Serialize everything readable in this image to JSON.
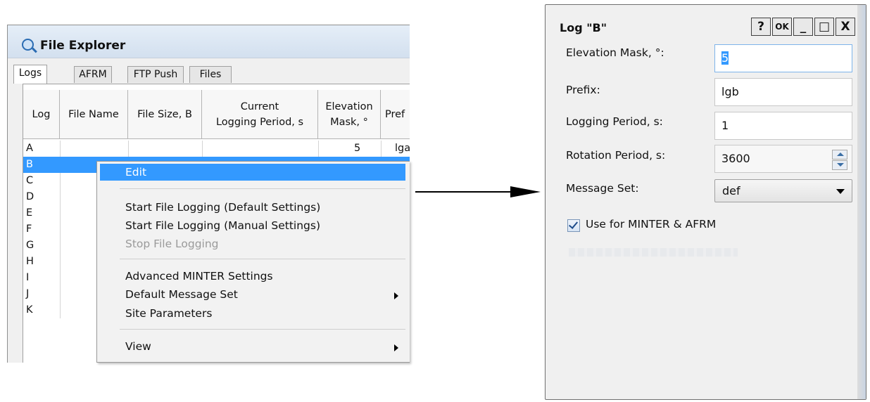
{
  "file_explorer": {
    "title": "File Explorer",
    "tabs": [
      "Logs",
      "AFRM",
      "FTP Push",
      "Files"
    ],
    "columns": [
      "Log",
      "File Name",
      "File Size, B",
      "Current\nLogging Period, s",
      "Elevation\nMask, °",
      "Pref"
    ],
    "rows": [
      {
        "log": "A",
        "mask": "5",
        "prefix": "lga"
      },
      {
        "log": "B"
      },
      {
        "log": "C"
      },
      {
        "log": "D"
      },
      {
        "log": "E"
      },
      {
        "log": "F"
      },
      {
        "log": "G"
      },
      {
        "log": "H"
      },
      {
        "log": "I"
      },
      {
        "log": "J"
      },
      {
        "log": "K"
      }
    ],
    "selected_row": "B"
  },
  "context_menu": {
    "items": [
      {
        "label": "Edit",
        "highlighted": true
      },
      {
        "label": "Start File Logging (Default Settings)"
      },
      {
        "label": "Start File Logging (Manual Settings)"
      },
      {
        "label": "Stop File Logging",
        "disabled": true
      },
      {
        "label": "Advanced MINTER Settings"
      },
      {
        "label": "Default Message Set",
        "submenu": true
      },
      {
        "label": "Site Parameters"
      },
      {
        "label": "View",
        "submenu": true
      }
    ]
  },
  "dialog": {
    "title": "Log \"B\"",
    "buttons": {
      "help": "?",
      "ok": "OK",
      "minimize": "_",
      "maximize": "□",
      "close": "X"
    },
    "fields": {
      "elevation_mask": {
        "label": "Elevation Mask, °:",
        "value": "5"
      },
      "prefix": {
        "label": "Prefix:",
        "value": "lgb"
      },
      "logging_period": {
        "label": "Logging Period, s:",
        "value": "1"
      },
      "rotation_period": {
        "label": "Rotation Period, s:",
        "value": "3600"
      },
      "message_set": {
        "label": "Message Set:",
        "value": "def"
      }
    },
    "checkbox": {
      "label": "Use for MINTER & AFRM",
      "checked": true
    }
  },
  "colors": {
    "selection": "#3399ff",
    "title_bar": "#d3e0ef"
  }
}
